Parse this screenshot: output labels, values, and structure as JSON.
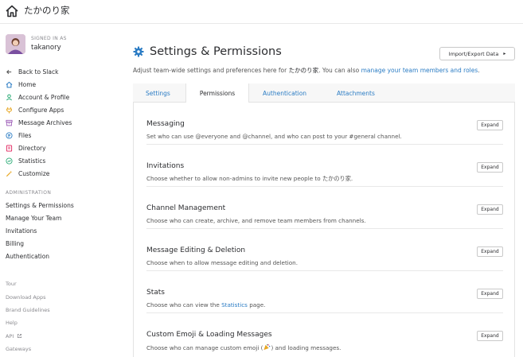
{
  "topbar": {
    "team_name": "たかのり家"
  },
  "user": {
    "signed_in_label": "SIGNED IN AS",
    "username": "takanory"
  },
  "sidebar": {
    "items": [
      {
        "label": "Back to Slack",
        "icon": "arrow-left-icon",
        "color": "#555555"
      },
      {
        "label": "Home",
        "icon": "home-icon",
        "color": "#2b7cc4"
      },
      {
        "label": "Account & Profile",
        "icon": "person-icon",
        "color": "#2bac76"
      },
      {
        "label": "Configure Apps",
        "icon": "plug-icon",
        "color": "#e8a723"
      },
      {
        "label": "Message Archives",
        "icon": "archive-icon",
        "color": "#9b59b6"
      },
      {
        "label": "Files",
        "icon": "file-icon",
        "color": "#2b7cc4"
      },
      {
        "label": "Directory",
        "icon": "book-icon",
        "color": "#e01e5a"
      },
      {
        "label": "Statistics",
        "icon": "stats-icon",
        "color": "#2bac76"
      },
      {
        "label": "Customize",
        "icon": "wand-icon",
        "color": "#e8a723"
      }
    ],
    "admin_label": "ADMINISTRATION",
    "admin_items": [
      "Settings & Permissions",
      "Manage Your Team",
      "Invitations",
      "Billing",
      "Authentication"
    ],
    "footer_items": [
      "Tour",
      "Download Apps",
      "Brand Guidelines",
      "Help",
      "API",
      "Gateways"
    ]
  },
  "main": {
    "title": "Settings & Permissions",
    "import_export_label": "Import/Export Data",
    "description": {
      "prefix": "Adjust team-wide settings and preferences here for ",
      "team": "たかのり家",
      "middle": ". You can also ",
      "link": "manage your team members and roles",
      "suffix": "."
    },
    "tabs": [
      "Settings",
      "Permissions",
      "Authentication",
      "Attachments"
    ],
    "active_tab": "Permissions",
    "expand_label": "Expand",
    "sections": [
      {
        "title": "Messaging",
        "desc": "Set who can use @everyone and @channel, and who can post to your #general channel."
      },
      {
        "title": "Invitations",
        "desc": "Choose whether to allow non-admins to invite new people to たかのり家."
      },
      {
        "title": "Channel Management",
        "desc": "Choose who can create, archive, and remove team members from channels."
      },
      {
        "title": "Message Editing & Deletion",
        "desc": "Choose when to allow message editing and deletion."
      },
      {
        "title": "Stats",
        "desc_prefix": "Choose who can view the ",
        "desc_link": "Statistics",
        "desc_suffix": " page."
      },
      {
        "title": "Custom Emoji & Loading Messages",
        "desc_prefix": "Choose who can manage custom emoji (",
        "desc_suffix": ") and loading messages."
      }
    ]
  },
  "colors": {
    "link": "#2b7cc4",
    "gear": "#2b7cc4"
  }
}
